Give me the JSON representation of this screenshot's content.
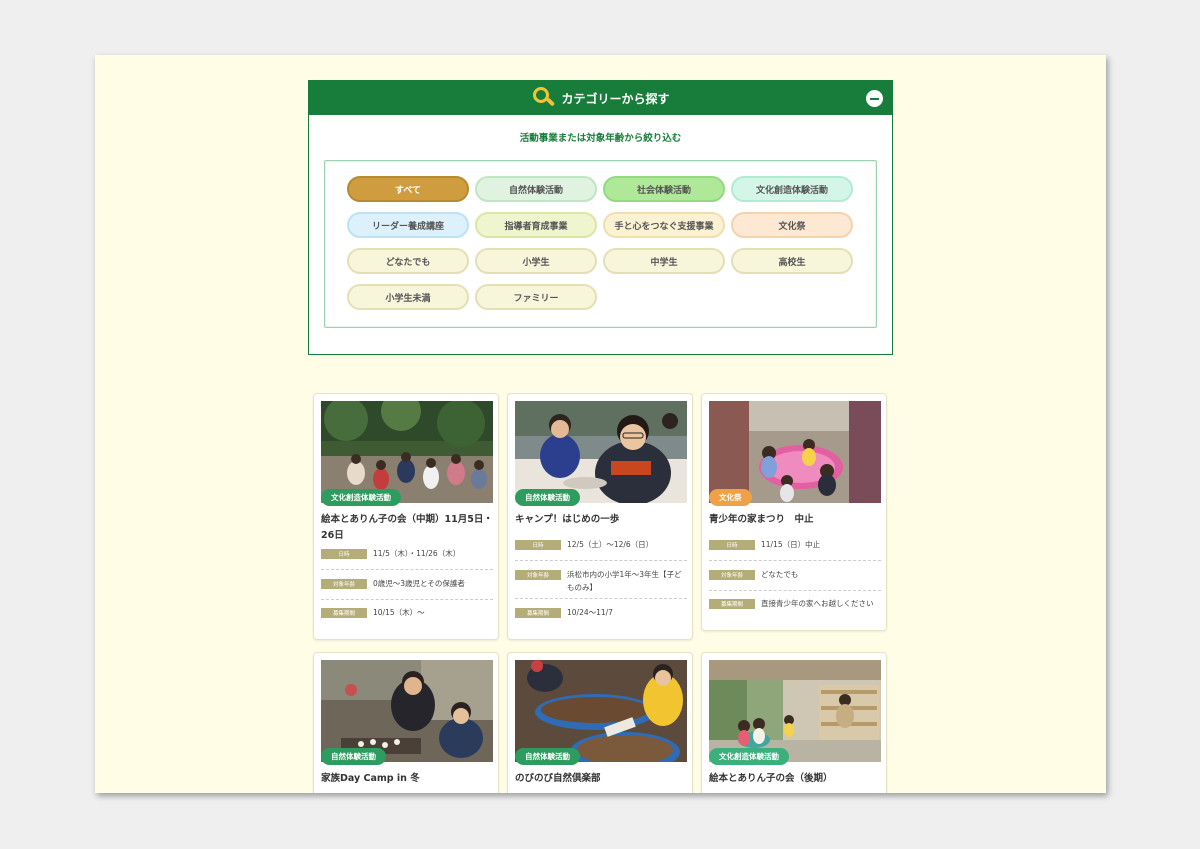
{
  "category_panel": {
    "title": "カテゴリーから探す",
    "subtitle": "活動事業または対象年齢から絞り込む",
    "tags": [
      {
        "label": "すべて",
        "style": "active",
        "name": "tag-all"
      },
      {
        "label": "自然体験活動",
        "style": "g1",
        "name": "tag-nature-experience"
      },
      {
        "label": "社会体験活動",
        "style": "g2",
        "name": "tag-social-experience"
      },
      {
        "label": "文化創造体験活動",
        "style": "g3",
        "name": "tag-culture-creation"
      },
      {
        "label": "リーダー養成講座",
        "style": "b1",
        "name": "tag-leader-training"
      },
      {
        "label": "指導者育成事業",
        "style": "y1",
        "name": "tag-instructor-training"
      },
      {
        "label": "手と心をつなぐ支援事業",
        "style": "y2",
        "name": "tag-support-project"
      },
      {
        "label": "文化祭",
        "style": "o1",
        "name": "tag-culture-festival"
      },
      {
        "label": "どなたでも",
        "style": "n1",
        "name": "tag-anyone"
      },
      {
        "label": "小学生",
        "style": "n1",
        "name": "tag-elementary"
      },
      {
        "label": "中学生",
        "style": "n1",
        "name": "tag-junior-high"
      },
      {
        "label": "高校生",
        "style": "n1",
        "name": "tag-high-school"
      },
      {
        "label": "小学生未満",
        "style": "n1",
        "name": "tag-preschool"
      },
      {
        "label": "ファミリー",
        "style": "n1",
        "name": "tag-family"
      }
    ]
  },
  "labels": {
    "date": "日時",
    "age": "対象年齢",
    "period": "募集期間"
  },
  "cards": [
    {
      "badge": "文化創造体験活動",
      "badge_color": "green",
      "title": "絵本とありん子の会（中期）11月5日・26日",
      "date": "11/5（木）・11/26（木）",
      "age": "0歳児〜3歳児とその保護者",
      "period": "10/15（木）〜"
    },
    {
      "badge": "自然体験活動",
      "badge_color": "green",
      "title": "キャンプ！はじめの一歩",
      "date": "12/5（土）〜12/6（日）",
      "age": "浜松市内の小学1年〜3年生【子どものみ】",
      "period": "10/24〜11/7"
    },
    {
      "badge": "文化祭",
      "badge_color": "orange",
      "title": "青少年の家まつり　中止",
      "date": "11/15（日）中止",
      "age": "どなたでも",
      "period": "直接青少年の家へお越しください"
    },
    {
      "badge": "自然体験活動",
      "badge_color": "green",
      "title": "家族Day Camp in 冬"
    },
    {
      "badge": "自然体験活動",
      "badge_color": "green",
      "title": "のびのび自然倶楽部"
    },
    {
      "badge": "文化創造体験活動",
      "badge_color": "teal",
      "title": "絵本とありん子の会（後期）"
    }
  ]
}
